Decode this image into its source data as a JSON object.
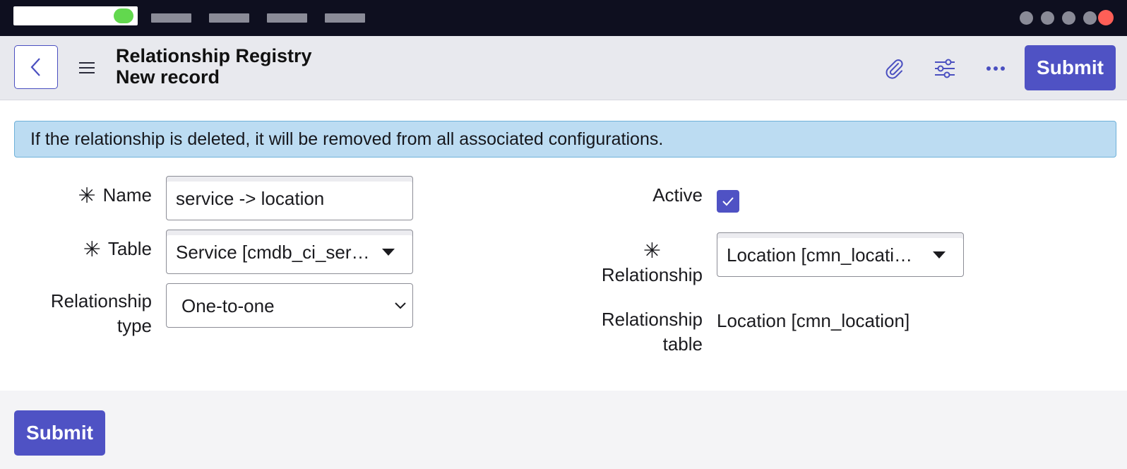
{
  "header": {
    "title_line1": "Relationship Registry",
    "title_line2": "New record",
    "submit_label": "Submit"
  },
  "banner": {
    "message": "If the relationship is deleted, it will be removed from all associated configurations."
  },
  "form": {
    "name": {
      "label": "Name",
      "required": "✳",
      "value": "service -> location"
    },
    "table": {
      "label": "Table",
      "required": "✳",
      "value": "Service [cmdb_ci_ser…"
    },
    "relationship_type": {
      "label_line1": "Relationship",
      "label_line2": "type",
      "value": "One-to-one"
    },
    "active": {
      "label": "Active",
      "checked": true
    },
    "relationship": {
      "label": "Relationship",
      "required": "✳",
      "value": "Location [cmn_locati…"
    },
    "relationship_table": {
      "label_line1": "Relationship",
      "label_line2": "table",
      "value": "Location [cmn_location]"
    }
  },
  "footer": {
    "submit_label": "Submit"
  },
  "colors": {
    "accent": "#4f52c4",
    "banner_bg": "#bcdcf2",
    "topbar_bg": "#0e0f1f",
    "status_green": "#62d84e",
    "close_red": "#ff5f57"
  },
  "icons": {
    "back": "chevron-left-icon",
    "menu": "hamburger-menu-icon",
    "attach": "paperclip-icon",
    "settings": "sliders-icon",
    "more": "ellipsis-icon",
    "check": "checkmark-icon",
    "dropdown": "caret-down-icon",
    "required": "asterisk-icon"
  }
}
